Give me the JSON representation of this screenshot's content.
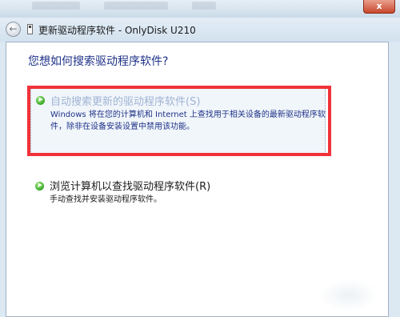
{
  "window": {
    "title": "更新驱动程序软件 - OnlyDisk U210",
    "close_label": "x"
  },
  "dialog": {
    "question": "您想如何搜索驱动程序软件?"
  },
  "options": [
    {
      "title": "自动搜索更新的驱动程序软件(S)",
      "description": "Windows 将在您的计算机和 Internet 上查找用于相关设备的最新驱动程序软件，除非在设备安装设置中禁用该功能。"
    },
    {
      "title": "浏览计算机以查找驱动程序软件(R)",
      "description": "手动查找并安装驱动程序软件。"
    }
  ],
  "colors": {
    "highlight_border": "#f0323a",
    "heading": "#1e3287",
    "option1_title": "#9fb3d3",
    "option2_title": "#1a1a1a"
  }
}
